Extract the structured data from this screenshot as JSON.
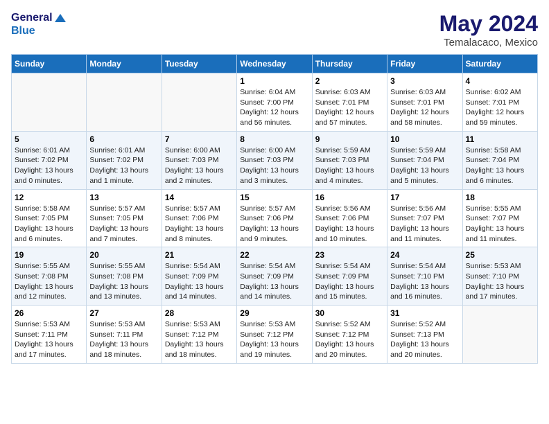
{
  "header": {
    "logo_line1": "General",
    "logo_line2": "Blue",
    "month": "May 2024",
    "location": "Temalacaco, Mexico"
  },
  "weekdays": [
    "Sunday",
    "Monday",
    "Tuesday",
    "Wednesday",
    "Thursday",
    "Friday",
    "Saturday"
  ],
  "weeks": [
    [
      {
        "day": "",
        "info": ""
      },
      {
        "day": "",
        "info": ""
      },
      {
        "day": "",
        "info": ""
      },
      {
        "day": "1",
        "info": "Sunrise: 6:04 AM\nSunset: 7:00 PM\nDaylight: 12 hours\nand 56 minutes."
      },
      {
        "day": "2",
        "info": "Sunrise: 6:03 AM\nSunset: 7:01 PM\nDaylight: 12 hours\nand 57 minutes."
      },
      {
        "day": "3",
        "info": "Sunrise: 6:03 AM\nSunset: 7:01 PM\nDaylight: 12 hours\nand 58 minutes."
      },
      {
        "day": "4",
        "info": "Sunrise: 6:02 AM\nSunset: 7:01 PM\nDaylight: 12 hours\nand 59 minutes."
      }
    ],
    [
      {
        "day": "5",
        "info": "Sunrise: 6:01 AM\nSunset: 7:02 PM\nDaylight: 13 hours\nand 0 minutes."
      },
      {
        "day": "6",
        "info": "Sunrise: 6:01 AM\nSunset: 7:02 PM\nDaylight: 13 hours\nand 1 minute."
      },
      {
        "day": "7",
        "info": "Sunrise: 6:00 AM\nSunset: 7:03 PM\nDaylight: 13 hours\nand 2 minutes."
      },
      {
        "day": "8",
        "info": "Sunrise: 6:00 AM\nSunset: 7:03 PM\nDaylight: 13 hours\nand 3 minutes."
      },
      {
        "day": "9",
        "info": "Sunrise: 5:59 AM\nSunset: 7:03 PM\nDaylight: 13 hours\nand 4 minutes."
      },
      {
        "day": "10",
        "info": "Sunrise: 5:59 AM\nSunset: 7:04 PM\nDaylight: 13 hours\nand 5 minutes."
      },
      {
        "day": "11",
        "info": "Sunrise: 5:58 AM\nSunset: 7:04 PM\nDaylight: 13 hours\nand 6 minutes."
      }
    ],
    [
      {
        "day": "12",
        "info": "Sunrise: 5:58 AM\nSunset: 7:05 PM\nDaylight: 13 hours\nand 6 minutes."
      },
      {
        "day": "13",
        "info": "Sunrise: 5:57 AM\nSunset: 7:05 PM\nDaylight: 13 hours\nand 7 minutes."
      },
      {
        "day": "14",
        "info": "Sunrise: 5:57 AM\nSunset: 7:06 PM\nDaylight: 13 hours\nand 8 minutes."
      },
      {
        "day": "15",
        "info": "Sunrise: 5:57 AM\nSunset: 7:06 PM\nDaylight: 13 hours\nand 9 minutes."
      },
      {
        "day": "16",
        "info": "Sunrise: 5:56 AM\nSunset: 7:06 PM\nDaylight: 13 hours\nand 10 minutes."
      },
      {
        "day": "17",
        "info": "Sunrise: 5:56 AM\nSunset: 7:07 PM\nDaylight: 13 hours\nand 11 minutes."
      },
      {
        "day": "18",
        "info": "Sunrise: 5:55 AM\nSunset: 7:07 PM\nDaylight: 13 hours\nand 11 minutes."
      }
    ],
    [
      {
        "day": "19",
        "info": "Sunrise: 5:55 AM\nSunset: 7:08 PM\nDaylight: 13 hours\nand 12 minutes."
      },
      {
        "day": "20",
        "info": "Sunrise: 5:55 AM\nSunset: 7:08 PM\nDaylight: 13 hours\nand 13 minutes."
      },
      {
        "day": "21",
        "info": "Sunrise: 5:54 AM\nSunset: 7:09 PM\nDaylight: 13 hours\nand 14 minutes."
      },
      {
        "day": "22",
        "info": "Sunrise: 5:54 AM\nSunset: 7:09 PM\nDaylight: 13 hours\nand 14 minutes."
      },
      {
        "day": "23",
        "info": "Sunrise: 5:54 AM\nSunset: 7:09 PM\nDaylight: 13 hours\nand 15 minutes."
      },
      {
        "day": "24",
        "info": "Sunrise: 5:54 AM\nSunset: 7:10 PM\nDaylight: 13 hours\nand 16 minutes."
      },
      {
        "day": "25",
        "info": "Sunrise: 5:53 AM\nSunset: 7:10 PM\nDaylight: 13 hours\nand 17 minutes."
      }
    ],
    [
      {
        "day": "26",
        "info": "Sunrise: 5:53 AM\nSunset: 7:11 PM\nDaylight: 13 hours\nand 17 minutes."
      },
      {
        "day": "27",
        "info": "Sunrise: 5:53 AM\nSunset: 7:11 PM\nDaylight: 13 hours\nand 18 minutes."
      },
      {
        "day": "28",
        "info": "Sunrise: 5:53 AM\nSunset: 7:12 PM\nDaylight: 13 hours\nand 18 minutes."
      },
      {
        "day": "29",
        "info": "Sunrise: 5:53 AM\nSunset: 7:12 PM\nDaylight: 13 hours\nand 19 minutes."
      },
      {
        "day": "30",
        "info": "Sunrise: 5:52 AM\nSunset: 7:12 PM\nDaylight: 13 hours\nand 20 minutes."
      },
      {
        "day": "31",
        "info": "Sunrise: 5:52 AM\nSunset: 7:13 PM\nDaylight: 13 hours\nand 20 minutes."
      },
      {
        "day": "",
        "info": ""
      }
    ]
  ]
}
